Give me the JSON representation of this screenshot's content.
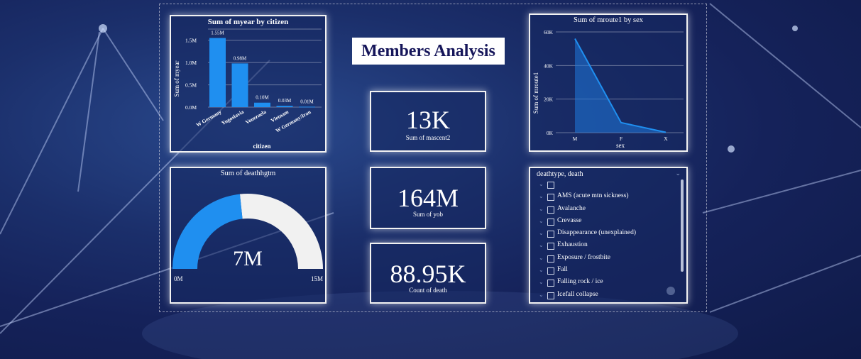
{
  "page_title": "Members Analysis",
  "bar_chart": {
    "title": "Sum of myear by citizen",
    "xlabel": "citizen",
    "ylabel": "Sum of myear",
    "y_ticks": [
      "0.0M",
      "0.5M",
      "1.0M",
      "1.5M"
    ]
  },
  "area_chart": {
    "title": "Sum of mroute1 by sex",
    "xlabel": "sex",
    "ylabel": "Sum of mroute1",
    "y_ticks": [
      "0K",
      "20K",
      "40K",
      "60K"
    ]
  },
  "gauge": {
    "title": "Sum of deathhgtm",
    "value_label": "7M",
    "min_label": "0M",
    "max_label": "15M",
    "value": 7,
    "max": 15,
    "fill_color": "#1f8ff0",
    "track_color": "#f1f1f1"
  },
  "kpis": [
    {
      "value": "13K",
      "label": "Sum of mascent2"
    },
    {
      "value": "164M",
      "label": "Sum of yob"
    },
    {
      "value": "88.95K",
      "label": "Count of death"
    }
  ],
  "slicer": {
    "header": "deathtype, death",
    "items": [
      "",
      "AMS (acute mtn sickness)",
      "Avalanche",
      "Crevasse",
      "Disappearance (unexplained)",
      "Exhaustion",
      "Exposure / frostbite",
      "Fall",
      "Falling rock / ice",
      "Icefall collapse"
    ]
  },
  "chart_data": [
    {
      "type": "bar",
      "title": "Sum of myear by citizen",
      "xlabel": "citizen",
      "ylabel": "Sum of myear",
      "categories": [
        "W Germany",
        "Yugoslavia",
        "Venezuela",
        "Vietnam",
        "W Germany/Iran"
      ],
      "values": [
        1.55,
        0.98,
        0.1,
        0.03,
        0.01
      ],
      "data_labels": [
        "1.55M",
        "0.98M",
        "0.10M",
        "0.03M",
        "0.01M"
      ],
      "ylim": [
        0,
        1.75
      ],
      "unit": "M",
      "color": "#1f8ff0",
      "grid": true
    },
    {
      "type": "area",
      "title": "Sum of mroute1 by sex",
      "xlabel": "sex",
      "ylabel": "Sum of mroute1",
      "categories": [
        "M",
        "F",
        "X"
      ],
      "values": [
        56000,
        6000,
        200
      ],
      "ylim": [
        0,
        60000
      ],
      "color": "#1f8ff0",
      "grid": true
    }
  ]
}
